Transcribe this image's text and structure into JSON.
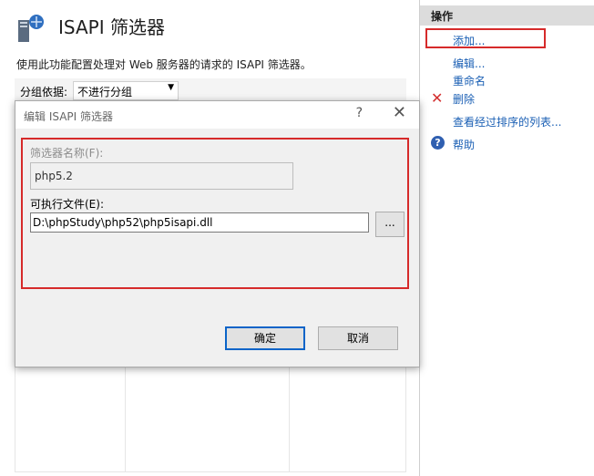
{
  "main": {
    "title": "ISAPI 筛选器",
    "description": "使用此功能配置处理对 Web 服务器的请求的 ISAPI 筛选器。",
    "group_by_label": "分组依据:",
    "group_by_value": "不进行分组"
  },
  "actions": {
    "header": "操作",
    "add": "添加...",
    "edit": "编辑...",
    "rename": "重命名",
    "delete": "删除",
    "view_sorted": "查看经过排序的列表...",
    "help": "帮助"
  },
  "dialog": {
    "title": "编辑 ISAPI 筛选器",
    "help_glyph": "?",
    "close_glyph": "✕",
    "name_label": "筛选器名称(F):",
    "name_value": "php5.2",
    "exe_label": "可执行文件(E):",
    "exe_value": "D:\\phpStudy\\php52\\php5isapi.dll",
    "browse_label": "...",
    "ok": "确定",
    "cancel": "取消"
  },
  "colors": {
    "accent_red": "#d62a2a",
    "link_blue": "#1a5fb4"
  }
}
